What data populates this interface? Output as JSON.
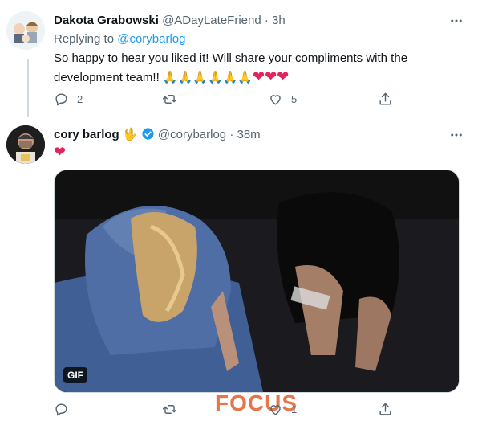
{
  "tweet1": {
    "name": "Dakota Grabowski",
    "handle": "@ADayLateFriend",
    "dot": "·",
    "time": "3h",
    "replying_prefix": "Replying to",
    "replying_to": "@corybarlog",
    "text_line1": "So happy to hear you liked it! Will share your compliments with the",
    "text_line2": "development team!!",
    "emoji": "🙏🙏🙏🙏🙏🙏",
    "hearts": "❤❤❤",
    "reply_count": "2",
    "retweet_count": "",
    "like_count": "5"
  },
  "tweet2": {
    "name": "cory barlog",
    "name_emoji": "🖖",
    "handle": "@corybarlog",
    "dot": "·",
    "time": "38m",
    "text": "❤",
    "gif_label": "GIF",
    "reply_count": "",
    "retweet_count": "",
    "like_count": "1"
  },
  "watermark": "FOCUS",
  "colors": {
    "accent": "#1d9bf0",
    "muted": "#536471",
    "heart": "#e0245e"
  }
}
